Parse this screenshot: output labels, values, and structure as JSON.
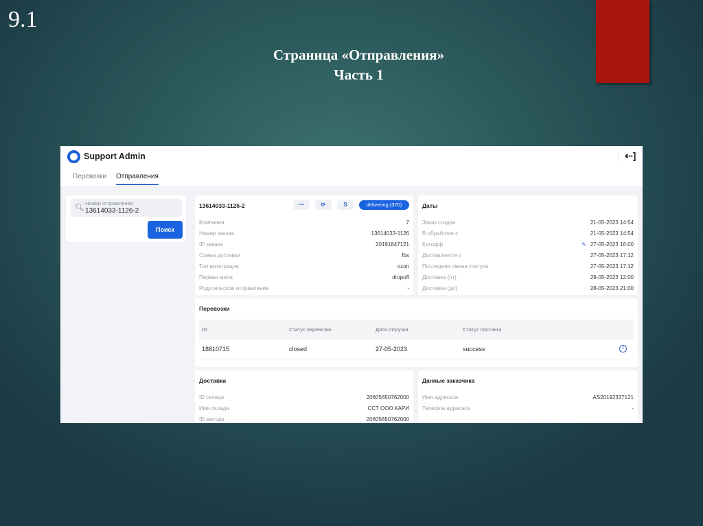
{
  "slide": {
    "number": "9.1",
    "title_line1": "Страница «Отправления»",
    "title_line2": "Часть 1",
    "accent_color": "#a8150f"
  },
  "app": {
    "title": "Support Admin",
    "brand_color": "#1a63e0",
    "logout_icon": "logout-icon"
  },
  "tabs": [
    {
      "label": "Перевозки",
      "active": false
    },
    {
      "label": "Отправления",
      "active": true
    }
  ],
  "search": {
    "placeholder": "Номер отправления",
    "value": "13614033-1126-2",
    "button": "Поиск"
  },
  "posting": {
    "title": "13614033-1126-2",
    "status_badge": "delivering (370)",
    "rows": [
      {
        "k": "Компания",
        "v": "7"
      },
      {
        "k": "Номер заказа",
        "v": "13614033-1126"
      },
      {
        "k": "ID заказа",
        "v": "20191847121"
      },
      {
        "k": "Схема доставки",
        "v": "fbs"
      },
      {
        "k": "Тип интеграции",
        "v": "ozon"
      },
      {
        "k": "Первая миля",
        "v": "dropoff"
      },
      {
        "k": "Родительское отправление",
        "v": "-"
      }
    ]
  },
  "dates": {
    "title": "Даты",
    "rows": [
      {
        "k": "Заказ создан",
        "v": "21-05-2023 14:54"
      },
      {
        "k": "В обработке с",
        "v": "21-05-2023 14:54"
      },
      {
        "k": "Катофф",
        "v": "27-05-2023 16:00"
      },
      {
        "k": "Доставляется с",
        "v": "27-05-2023 17:12"
      },
      {
        "k": "Последняя смена статуса",
        "v": "27-05-2023 17:12"
      },
      {
        "k": "Доставка (от)",
        "v": "28-05-2023 12:00"
      },
      {
        "k": "Доставка (до)",
        "v": "28-05-2023 21:00"
      }
    ]
  },
  "shipments": {
    "title": "Перевозки",
    "columns": [
      "ID",
      "Статус перевозки",
      "Дата отгрузки",
      "Статус постинга"
    ],
    "rows": [
      [
        "18810715",
        "closed",
        "27-05-2023",
        "success"
      ]
    ]
  },
  "delivery": {
    "title": "Доставка",
    "rows": [
      {
        "k": "ID склада",
        "v": "20605650762000"
      },
      {
        "k": "Имя склада",
        "v": "ССТ ООО КАРИ"
      },
      {
        "k": "ID метода",
        "v": "20605650762000"
      }
    ]
  },
  "customer": {
    "title": "Данные заказчика",
    "rows": [
      {
        "k": "Имя адресата",
        "v": "AS20192337121"
      },
      {
        "k": "Телефон адресата",
        "v": "-"
      }
    ]
  }
}
